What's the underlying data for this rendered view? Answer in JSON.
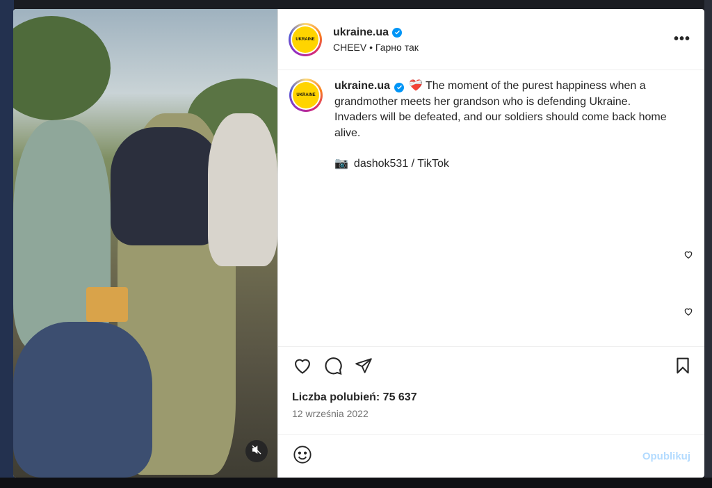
{
  "post": {
    "username": "ukraine.ua",
    "audio": "CHEEV • Гарно так",
    "avatar_logo_text": "UKRAINE",
    "more_icon": "more-horizontal-icon",
    "caption_emoji": "❤️‍🩹",
    "caption": "The moment of the purest happiness when a grandmother meets her grandson who is defending Ukraine. Invaders will be defeated, and our soldiers should come back home alive.",
    "credit_emoji": "📷",
    "credit": "dashok531 / TikTok",
    "likes": "Liczba polubień: 75 637",
    "date": "12 września 2022",
    "comment_placeholder": "",
    "publish_label": "Opublikuj"
  },
  "icons": {
    "like": "heart-icon",
    "comment": "comment-icon",
    "share": "send-icon",
    "save": "bookmark-icon",
    "emoji": "emoji-icon",
    "mute": "muted-speaker-icon"
  },
  "colors": {
    "verified": "#0095f6",
    "avatar_logo": "#ffd400",
    "publish_disabled": "#b3dbff"
  }
}
